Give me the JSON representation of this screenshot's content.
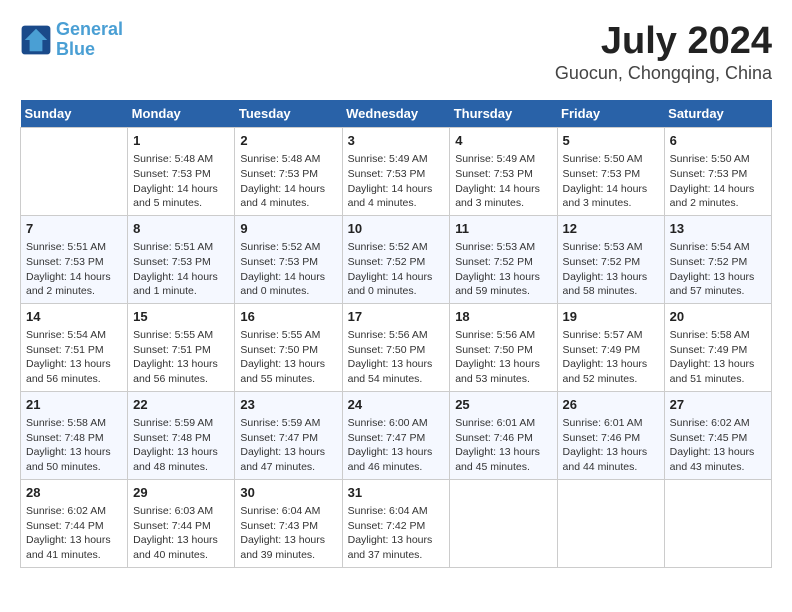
{
  "header": {
    "logo_line1": "General",
    "logo_line2": "Blue",
    "month": "July 2024",
    "location": "Guocun, Chongqing, China"
  },
  "weekdays": [
    "Sunday",
    "Monday",
    "Tuesday",
    "Wednesday",
    "Thursday",
    "Friday",
    "Saturday"
  ],
  "weeks": [
    [
      {
        "day": "",
        "info": ""
      },
      {
        "day": "1",
        "info": "Sunrise: 5:48 AM\nSunset: 7:53 PM\nDaylight: 14 hours\nand 5 minutes."
      },
      {
        "day": "2",
        "info": "Sunrise: 5:48 AM\nSunset: 7:53 PM\nDaylight: 14 hours\nand 4 minutes."
      },
      {
        "day": "3",
        "info": "Sunrise: 5:49 AM\nSunset: 7:53 PM\nDaylight: 14 hours\nand 4 minutes."
      },
      {
        "day": "4",
        "info": "Sunrise: 5:49 AM\nSunset: 7:53 PM\nDaylight: 14 hours\nand 3 minutes."
      },
      {
        "day": "5",
        "info": "Sunrise: 5:50 AM\nSunset: 7:53 PM\nDaylight: 14 hours\nand 3 minutes."
      },
      {
        "day": "6",
        "info": "Sunrise: 5:50 AM\nSunset: 7:53 PM\nDaylight: 14 hours\nand 2 minutes."
      }
    ],
    [
      {
        "day": "7",
        "info": "Sunrise: 5:51 AM\nSunset: 7:53 PM\nDaylight: 14 hours\nand 2 minutes."
      },
      {
        "day": "8",
        "info": "Sunrise: 5:51 AM\nSunset: 7:53 PM\nDaylight: 14 hours\nand 1 minute."
      },
      {
        "day": "9",
        "info": "Sunrise: 5:52 AM\nSunset: 7:53 PM\nDaylight: 14 hours\nand 0 minutes."
      },
      {
        "day": "10",
        "info": "Sunrise: 5:52 AM\nSunset: 7:52 PM\nDaylight: 14 hours\nand 0 minutes."
      },
      {
        "day": "11",
        "info": "Sunrise: 5:53 AM\nSunset: 7:52 PM\nDaylight: 13 hours\nand 59 minutes."
      },
      {
        "day": "12",
        "info": "Sunrise: 5:53 AM\nSunset: 7:52 PM\nDaylight: 13 hours\nand 58 minutes."
      },
      {
        "day": "13",
        "info": "Sunrise: 5:54 AM\nSunset: 7:52 PM\nDaylight: 13 hours\nand 57 minutes."
      }
    ],
    [
      {
        "day": "14",
        "info": "Sunrise: 5:54 AM\nSunset: 7:51 PM\nDaylight: 13 hours\nand 56 minutes."
      },
      {
        "day": "15",
        "info": "Sunrise: 5:55 AM\nSunset: 7:51 PM\nDaylight: 13 hours\nand 56 minutes."
      },
      {
        "day": "16",
        "info": "Sunrise: 5:55 AM\nSunset: 7:50 PM\nDaylight: 13 hours\nand 55 minutes."
      },
      {
        "day": "17",
        "info": "Sunrise: 5:56 AM\nSunset: 7:50 PM\nDaylight: 13 hours\nand 54 minutes."
      },
      {
        "day": "18",
        "info": "Sunrise: 5:56 AM\nSunset: 7:50 PM\nDaylight: 13 hours\nand 53 minutes."
      },
      {
        "day": "19",
        "info": "Sunrise: 5:57 AM\nSunset: 7:49 PM\nDaylight: 13 hours\nand 52 minutes."
      },
      {
        "day": "20",
        "info": "Sunrise: 5:58 AM\nSunset: 7:49 PM\nDaylight: 13 hours\nand 51 minutes."
      }
    ],
    [
      {
        "day": "21",
        "info": "Sunrise: 5:58 AM\nSunset: 7:48 PM\nDaylight: 13 hours\nand 50 minutes."
      },
      {
        "day": "22",
        "info": "Sunrise: 5:59 AM\nSunset: 7:48 PM\nDaylight: 13 hours\nand 48 minutes."
      },
      {
        "day": "23",
        "info": "Sunrise: 5:59 AM\nSunset: 7:47 PM\nDaylight: 13 hours\nand 47 minutes."
      },
      {
        "day": "24",
        "info": "Sunrise: 6:00 AM\nSunset: 7:47 PM\nDaylight: 13 hours\nand 46 minutes."
      },
      {
        "day": "25",
        "info": "Sunrise: 6:01 AM\nSunset: 7:46 PM\nDaylight: 13 hours\nand 45 minutes."
      },
      {
        "day": "26",
        "info": "Sunrise: 6:01 AM\nSunset: 7:46 PM\nDaylight: 13 hours\nand 44 minutes."
      },
      {
        "day": "27",
        "info": "Sunrise: 6:02 AM\nSunset: 7:45 PM\nDaylight: 13 hours\nand 43 minutes."
      }
    ],
    [
      {
        "day": "28",
        "info": "Sunrise: 6:02 AM\nSunset: 7:44 PM\nDaylight: 13 hours\nand 41 minutes."
      },
      {
        "day": "29",
        "info": "Sunrise: 6:03 AM\nSunset: 7:44 PM\nDaylight: 13 hours\nand 40 minutes."
      },
      {
        "day": "30",
        "info": "Sunrise: 6:04 AM\nSunset: 7:43 PM\nDaylight: 13 hours\nand 39 minutes."
      },
      {
        "day": "31",
        "info": "Sunrise: 6:04 AM\nSunset: 7:42 PM\nDaylight: 13 hours\nand 37 minutes."
      },
      {
        "day": "",
        "info": ""
      },
      {
        "day": "",
        "info": ""
      },
      {
        "day": "",
        "info": ""
      }
    ]
  ]
}
